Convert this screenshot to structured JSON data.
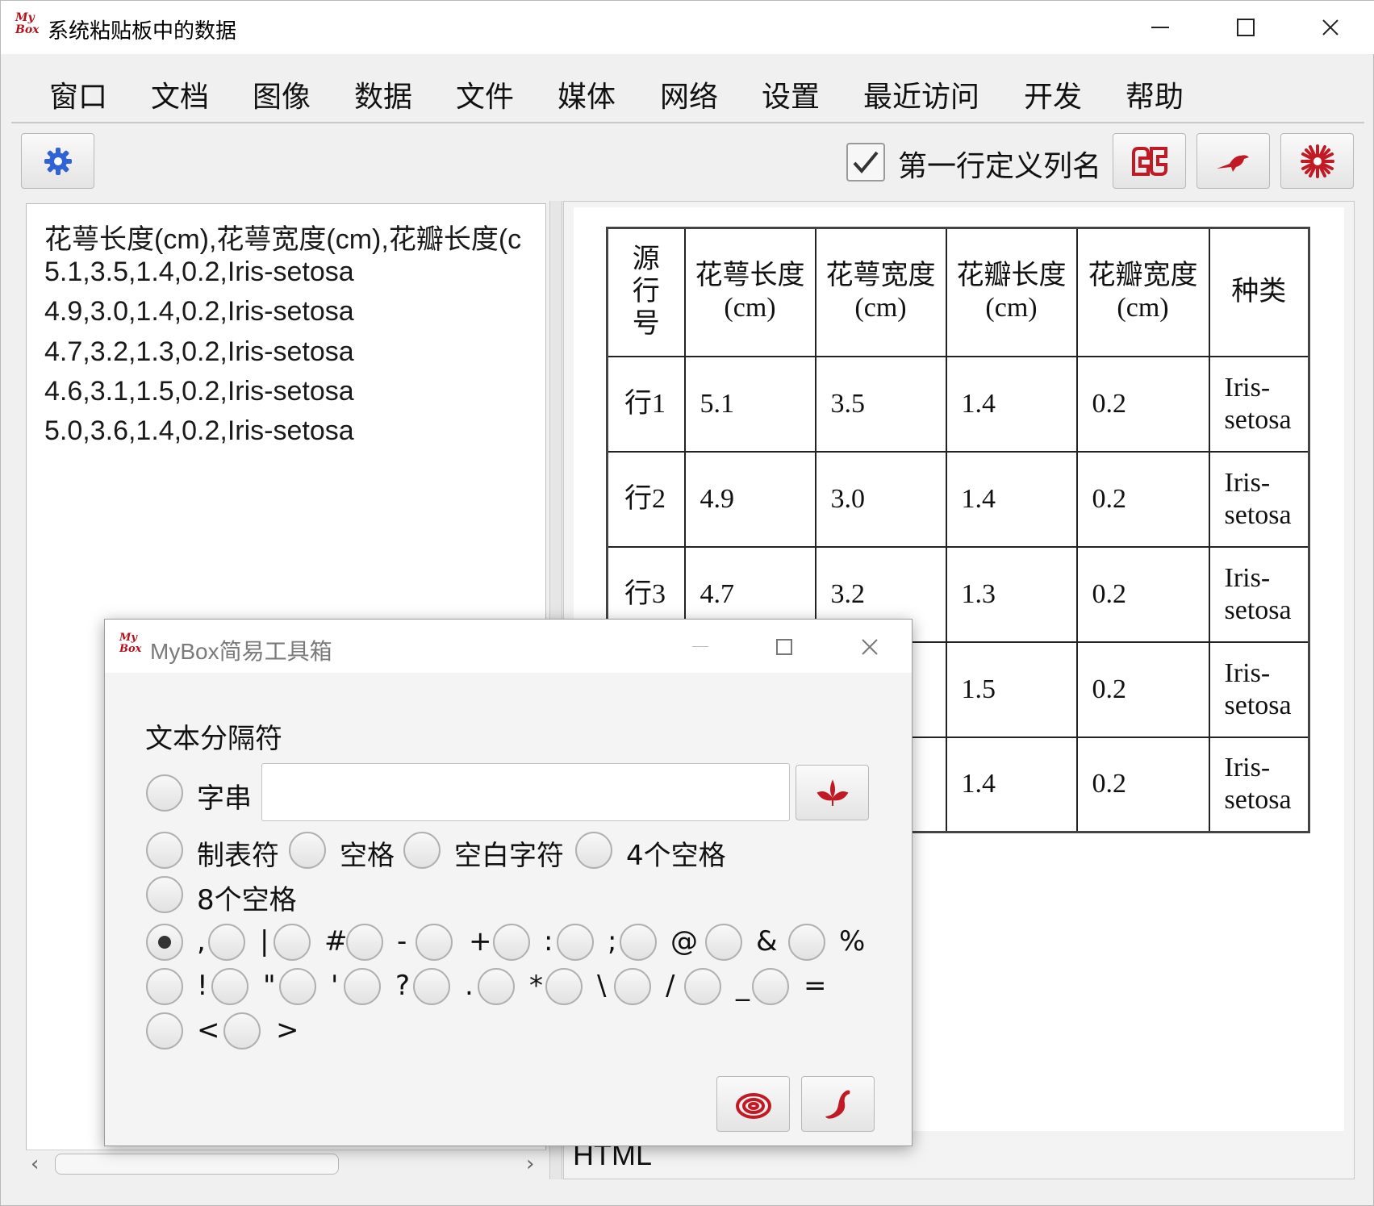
{
  "window": {
    "title": "系统粘贴板中的数据",
    "logo": "MyBox"
  },
  "menu": [
    "窗口",
    "文档",
    "图像",
    "数据",
    "文件",
    "媒体",
    "网络",
    "设置",
    "最近访问",
    "开发",
    "帮助"
  ],
  "toolbar": {
    "first_row_label": "第一行定义列名",
    "first_row_checked": true
  },
  "text_lines": [
    "花萼长度(cm),花萼宽度(cm),花瓣长度(c",
    "5.1,3.5,1.4,0.2,Iris-setosa",
    "4.9,3.0,1.4,0.2,Iris-setosa",
    "4.7,3.2,1.3,0.2,Iris-setosa",
    "4.6,3.1,1.5,0.2,Iris-setosa",
    "5.0,3.6,1.4,0.2,Iris-setosa"
  ],
  "table": {
    "headers": [
      "源行号",
      "花萼长度(cm)",
      "花萼宽度(cm)",
      "花瓣长度(cm)",
      "花瓣宽度(cm)",
      "种类"
    ],
    "rows": [
      [
        "行1",
        "5.1",
        "3.5",
        "1.4",
        "0.2",
        "Iris-setosa"
      ],
      [
        "行2",
        "4.9",
        "3.0",
        "1.4",
        "0.2",
        "Iris-setosa"
      ],
      [
        "行3",
        "4.7",
        "3.2",
        "1.3",
        "0.2",
        "Iris-setosa"
      ],
      [
        "",
        "",
        "",
        "1.5",
        "0.2",
        "Iris-setosa"
      ],
      [
        "",
        "",
        "",
        "1.4",
        "0.2",
        "Iris-setosa"
      ]
    ]
  },
  "html_tab_label": "HTML",
  "dialog": {
    "title": "MyBox简易工具箱",
    "heading": "文本分隔符",
    "string_option": "字串",
    "string_value": "",
    "options_row1": [
      "制表符",
      "空格",
      "空白字符",
      "4个空格"
    ],
    "options_row2": [
      "8个空格"
    ],
    "symbols_row1": [
      ",",
      "|",
      "#",
      "-",
      "+",
      ":",
      ";",
      "@",
      "&",
      "%"
    ],
    "symbols_row2": [
      "!",
      "\"",
      "'",
      "?",
      ".",
      "*",
      "\\",
      "/",
      "_",
      "="
    ],
    "symbols_row3": [
      "<",
      ">"
    ],
    "selected_separator": ","
  }
}
